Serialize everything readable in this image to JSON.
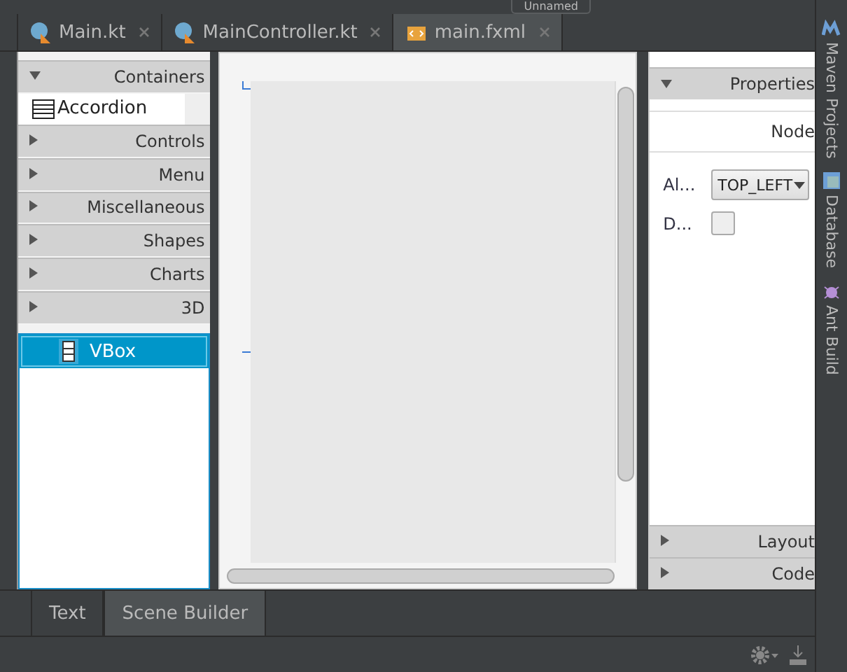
{
  "toolbar": {
    "run_config": "Unnamed"
  },
  "editor_tabs": [
    {
      "label": "Main.kt",
      "kind": "kotlin",
      "selected": false
    },
    {
      "label": "MainController.kt",
      "kind": "kotlin",
      "selected": false
    },
    {
      "label": "main.fxml",
      "kind": "fxml",
      "selected": true
    }
  ],
  "library": {
    "sections": [
      {
        "label": "Containers",
        "expanded": true,
        "items": [
          "Accordion"
        ]
      },
      {
        "label": "Controls",
        "expanded": false
      },
      {
        "label": "Menu",
        "expanded": false
      },
      {
        "label": "Miscellaneous",
        "expanded": false
      },
      {
        "label": "Shapes",
        "expanded": false
      },
      {
        "label": "Charts",
        "expanded": false
      },
      {
        "label": "3D",
        "expanded": false
      }
    ]
  },
  "hierarchy": [
    {
      "label": "VBox",
      "selected": true
    }
  ],
  "inspector": {
    "top_sections": [
      {
        "label": "Properties",
        "expanded": true
      }
    ],
    "subheader": "Node",
    "properties": [
      {
        "label": "Al...",
        "kind": "dropdown",
        "value": "TOP_LEFT"
      },
      {
        "label": "D...",
        "kind": "checkbox",
        "checked": false
      }
    ],
    "bottom_sections": [
      {
        "label": "Layout",
        "expanded": false
      },
      {
        "label": "Code",
        "expanded": false
      }
    ]
  },
  "tool_windows": [
    {
      "label": "Maven Projects",
      "kind": "maven"
    },
    {
      "label": "Database",
      "kind": "database"
    },
    {
      "label": "Ant Build",
      "kind": "ant"
    }
  ],
  "bottom_tabs": [
    {
      "label": "Text",
      "selected": false
    },
    {
      "label": "Scene Builder",
      "selected": true
    }
  ]
}
